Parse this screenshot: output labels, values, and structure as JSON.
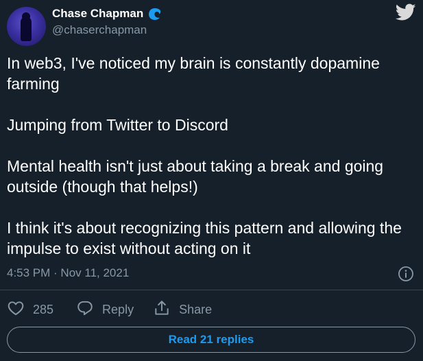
{
  "author": {
    "display_name": "Chase Chapman",
    "handle": "@chaserchapman",
    "badge_icon": "wave-icon",
    "badge_color": "#1d9bf0"
  },
  "platform_icon": "twitter-bird-icon",
  "tweet": {
    "paragraphs": [
      "In web3, I've noticed my brain is constantly dopamine farming",
      "Jumping from Twitter to Discord",
      "Mental health isn't just about taking a break and going outside (though that helps!)",
      "I think it's about recognizing this pattern and allowing the impulse to exist without acting on it"
    ],
    "timestamp": "4:53 PM · Nov 11, 2021"
  },
  "actions": {
    "like_count": "285",
    "reply_label": "Reply",
    "share_label": "Share"
  },
  "read_replies_label": "Read 21 replies",
  "colors": {
    "background": "#15202b",
    "text": "#ffffff",
    "muted": "#8899a6",
    "accent": "#1d9bf0",
    "divider": "#38444d"
  }
}
